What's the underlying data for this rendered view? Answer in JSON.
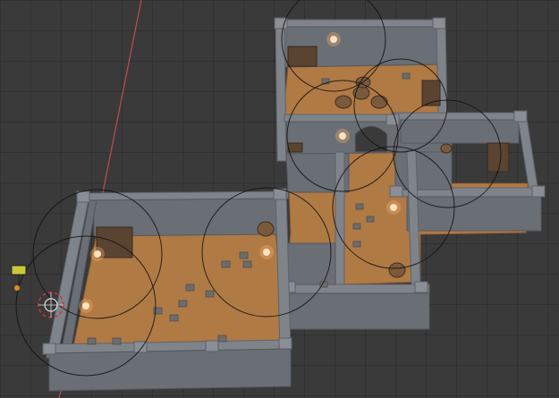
{
  "scene": {
    "background": "#3a3a3a",
    "axis_color": "#c44a5a",
    "floor_color": "#b07a45",
    "wall_color": "#7f838a",
    "light_color": "#ffe3c4"
  },
  "icons": {
    "sun": "sun-lamp-icon",
    "camera": "camera-icon",
    "torch": "point-light-icon"
  }
}
